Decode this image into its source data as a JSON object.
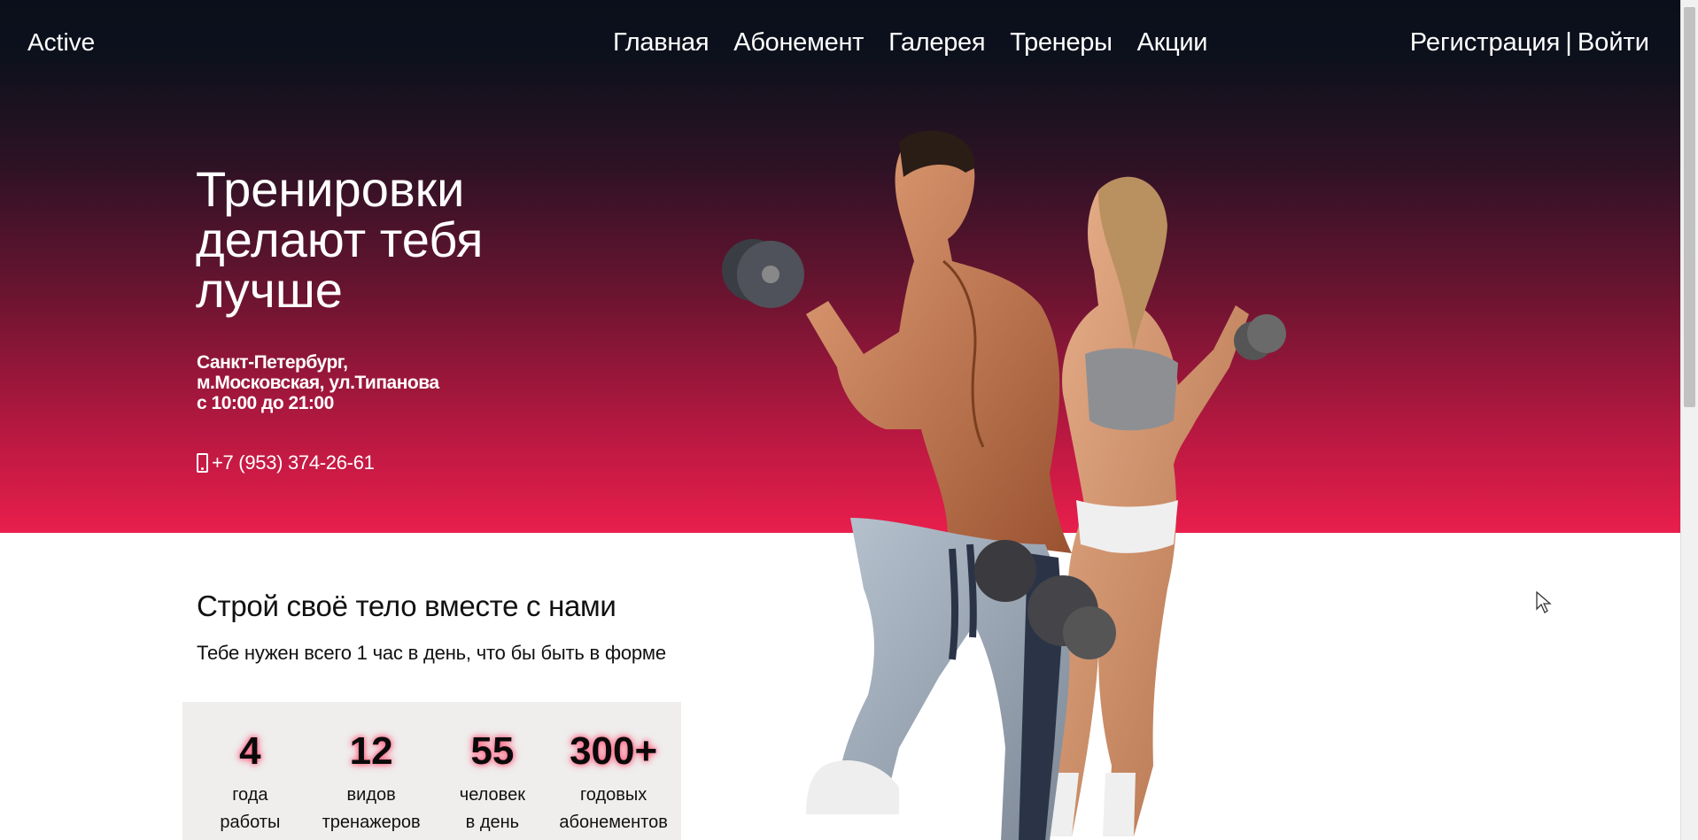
{
  "header": {
    "brand": "Active",
    "nav": [
      "Главная",
      "Абонемент",
      "Галерея",
      "Тренеры",
      "Акции"
    ],
    "register": "Регистрация",
    "separator": "|",
    "login": "Войти"
  },
  "hero": {
    "title": "Тренировки делают тебя лучше",
    "address_line1": "Санкт-Петербург,",
    "address_line2": "м.Московская, ул.Типанова",
    "hours": "с 10:00 до 21:00",
    "phone": "+7 (953) 374-26-61",
    "phone_icon": "mobile-phone-icon"
  },
  "intro": {
    "slogan": "Строй своё тело вместе с нами",
    "subtitle": "Тебе нужен всего 1 час в день, что бы быть в форме"
  },
  "stats": [
    {
      "value": "4",
      "line1": "года",
      "line2": "работы"
    },
    {
      "value": "12",
      "line1": "видов",
      "line2": "тренажеров"
    },
    {
      "value": "55",
      "line1": "человек",
      "line2": "в день"
    },
    {
      "value": "300+",
      "line1": "годовых",
      "line2": "абонементов"
    }
  ],
  "colors": {
    "hero_top": "#0b0f1b",
    "hero_bottom": "#e91e4c",
    "stats_bg": "#efeeed",
    "accent_glow": "#ff5a7a"
  }
}
